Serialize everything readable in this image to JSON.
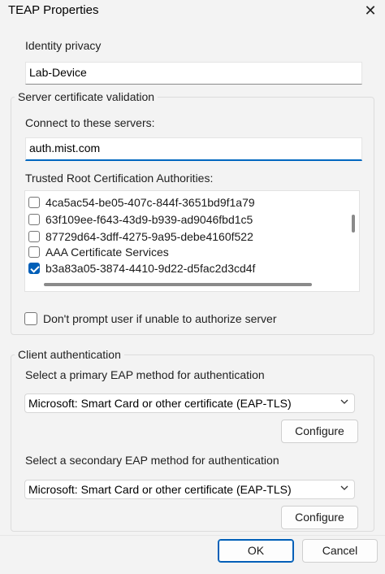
{
  "window": {
    "title": "TEAP Properties",
    "close_glyph": "✕"
  },
  "identity": {
    "label": "Identity privacy",
    "value": "Lab-Device"
  },
  "server_validation": {
    "group_title": "Server certificate validation",
    "connect_label": "Connect to these servers:",
    "connect_value": "auth.mist.com",
    "trusted_label": "Trusted Root Certification Authorities:",
    "cas": [
      {
        "name": "4ca5ac54-be05-407c-844f-3651bd9f1a79",
        "checked": false
      },
      {
        "name": "63f109ee-f643-43d9-b939-ad9046fbd1c5",
        "checked": false
      },
      {
        "name": "87729d64-3dff-4275-9a95-debe4160f522",
        "checked": false
      },
      {
        "name": "AAA Certificate Services",
        "checked": false
      },
      {
        "name": "b3a83a05-3874-4410-9d22-d5fac2d3cd4f",
        "checked": true
      }
    ],
    "dont_prompt_label": "Don't prompt user if unable to authorize server",
    "dont_prompt_checked": false
  },
  "client_auth": {
    "group_title": "Client authentication",
    "primary_label": "Select a primary EAP method for authentication",
    "primary_value": "Microsoft: Smart Card or other certificate (EAP-TLS)",
    "secondary_label": "Select a secondary EAP method for authentication",
    "secondary_value": "Microsoft: Smart Card or other certificate (EAP-TLS)",
    "configure_label": "Configure"
  },
  "footer": {
    "ok_label": "OK",
    "cancel_label": "Cancel"
  },
  "colors": {
    "accent": "#005fb8",
    "background": "#f3f3f3"
  }
}
